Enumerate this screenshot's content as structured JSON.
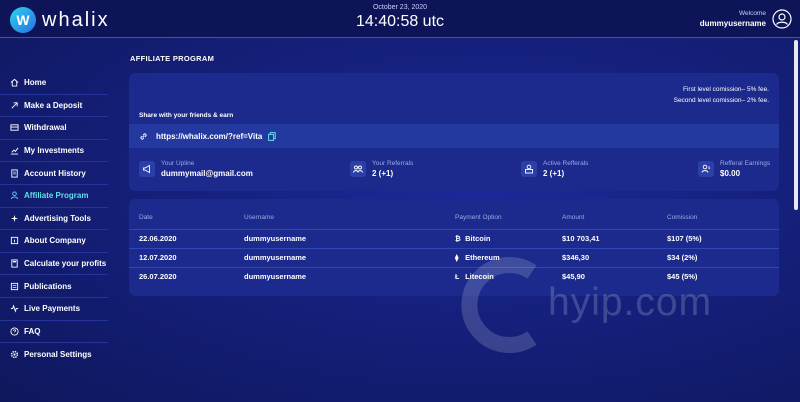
{
  "header": {
    "brand": "whalix",
    "logo_letter": "W",
    "date": "October 23, 2020",
    "time": "14:40:58 utc",
    "welcome_label": "Welcome",
    "username": "dummyusername"
  },
  "sidebar": {
    "items": [
      {
        "label": "Home",
        "icon": "home-icon"
      },
      {
        "label": "Make a Deposit",
        "icon": "deposit-icon"
      },
      {
        "label": "Withdrawal",
        "icon": "withdrawal-icon"
      },
      {
        "label": "My Investments",
        "icon": "investments-icon"
      },
      {
        "label": "Account History",
        "icon": "history-icon"
      },
      {
        "label": "Affiliate Program",
        "icon": "affiliate-icon",
        "active": true
      },
      {
        "label": "Advertising Tools",
        "icon": "advertising-icon"
      },
      {
        "label": "About Company",
        "icon": "about-icon"
      },
      {
        "label": "Calculate your profits",
        "icon": "calculator-icon"
      },
      {
        "label": "Publications",
        "icon": "publications-icon"
      },
      {
        "label": "Live Payments",
        "icon": "payments-icon"
      },
      {
        "label": "FAQ",
        "icon": "faq-icon"
      },
      {
        "label": "Personal Settings",
        "icon": "settings-icon"
      }
    ]
  },
  "main": {
    "title": "AFFILIATE PROGRAM",
    "commission_first": "First level comission– 5% fee.",
    "commission_second": "Second level comission– 2% fee.",
    "share_label": "Share with your friends & earn",
    "ref_link": "https://whalix.com/?ref=Vita",
    "stats": [
      {
        "label": "Your Upline",
        "value": "dummymail@gmail.com",
        "icon": "megaphone-icon"
      },
      {
        "label": "Your Referrals",
        "value": "2 (+1)",
        "icon": "referrals-icon"
      },
      {
        "label": "Active Refferals",
        "value": "2 (+1)",
        "icon": "active-referrals-icon"
      },
      {
        "label": "Refferal Earnings",
        "value": "$0.00",
        "icon": "earnings-icon"
      }
    ]
  },
  "table": {
    "headers": {
      "date": "Date",
      "username": "Username",
      "payment": "Payment Option",
      "amount": "Amount",
      "commission": "Comission"
    },
    "rows": [
      {
        "date": "22.06.2020",
        "username": "dummyusername",
        "coin_symbol": "₿",
        "payment": "Bitcoin",
        "amount": "$10 703,41",
        "commission": "$107 (5%)"
      },
      {
        "date": "12.07.2020",
        "username": "dummyusername",
        "coin_symbol": "⧫",
        "payment": "Ethereum",
        "amount": "$346,30",
        "commission": "$34 (2%)"
      },
      {
        "date": "26.07.2020",
        "username": "dummyusername",
        "coin_symbol": "Ł",
        "payment": "Litecoin",
        "amount": "$45,90",
        "commission": "$45 (5%)"
      }
    ]
  },
  "watermark": "hyip.com",
  "colors": {
    "accent": "#5fe0ea",
    "card": "#1b2a8c",
    "background": "#15207c"
  }
}
